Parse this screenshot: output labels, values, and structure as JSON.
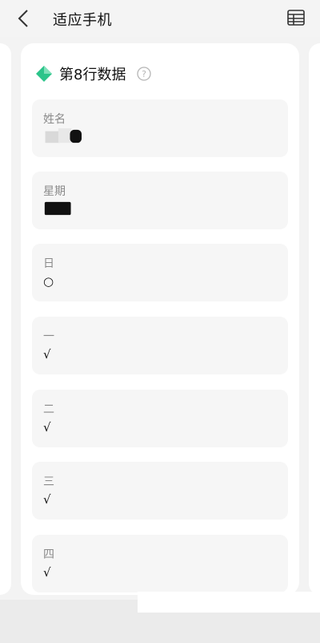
{
  "header": {
    "title": "适应手机",
    "back_icon": "chevron-left-icon",
    "table_icon": "table-icon"
  },
  "card": {
    "title": "第8行数据",
    "accent": "#2bc48a",
    "fields": [
      {
        "label": "姓名",
        "value": ""
      },
      {
        "label": "星期",
        "value": ""
      },
      {
        "label": "日",
        "value": "○"
      },
      {
        "label": "一",
        "value": "√"
      },
      {
        "label": "二",
        "value": "√"
      },
      {
        "label": "三",
        "value": "√"
      },
      {
        "label": "四",
        "value": "√"
      }
    ]
  }
}
